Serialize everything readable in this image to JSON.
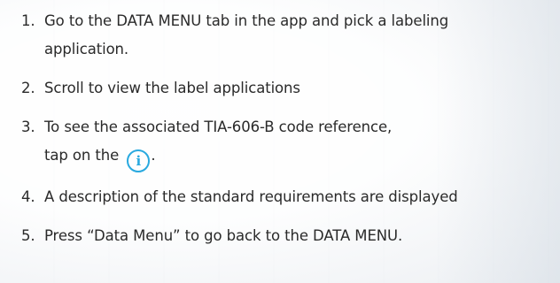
{
  "steps": [
    {
      "number": "1.",
      "text_line1": "Go to the DATA MENU tab in the app and pick a labeling",
      "text_line2": "application."
    },
    {
      "number": "2.",
      "text": "Scroll to view the label applications"
    },
    {
      "number": "3.",
      "text_line1": "To see the associated TIA-606-B code reference,",
      "text_line2_prefix": "tap on the",
      "icon": "info-icon",
      "icon_glyph": "i",
      "text_line2_suffix": "."
    },
    {
      "number": "4.",
      "text": "A description of the standard requirements are displayed"
    },
    {
      "number": "5.",
      "text": "Press “Data Menu” to go back to the DATA MENU."
    }
  ],
  "colors": {
    "text": "#2a2a2a",
    "info_icon": "#29a9df"
  }
}
